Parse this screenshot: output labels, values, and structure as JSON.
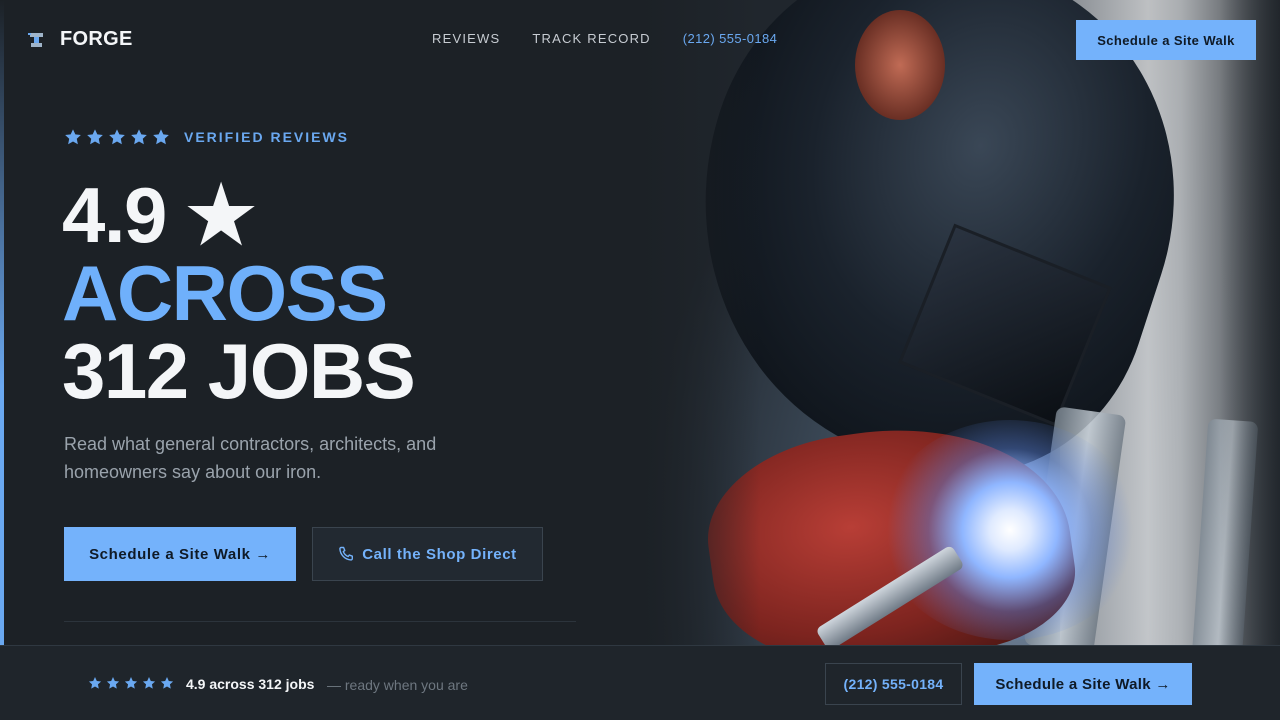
{
  "brand": {
    "name": "FORGE",
    "icon": "anvil-logo-icon"
  },
  "nav": {
    "links": [
      "REVIEWS",
      "TRACK RECORD"
    ],
    "phone": "(212) 555-0184",
    "cta": "Schedule a Site Walk"
  },
  "hero": {
    "rating_stars": 5,
    "eyebrow": "VERIFIED REVIEWS",
    "headline_line1": "4.9 ★",
    "headline_line2": "ACROSS",
    "headline_line3": "312 JOBS",
    "lede": "Read what general contractors, architects, and homeowners say about our iron.",
    "primary_cta": "Schedule a Site Walk →",
    "secondary_cta": "Call the Shop Direct",
    "secondary_icon": "phone-icon",
    "image": "welder-photo"
  },
  "bottom_bar": {
    "rating_stars": 5,
    "rating": "4.9 across 312 jobs",
    "tagline": "— ready when you are",
    "phone": "(212) 555-0184",
    "cta": "Schedule a Site Walk →"
  },
  "colors": {
    "accent": "#74b2fb",
    "background": "#1c2126",
    "bar": "#1f252b"
  }
}
